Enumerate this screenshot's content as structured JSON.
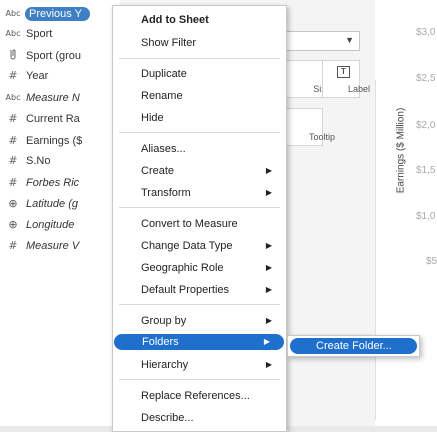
{
  "data_pane": {
    "fields": [
      {
        "type_icon": "Abc",
        "name": "Previous Y",
        "italic": false,
        "selected": true
      },
      {
        "type_icon": "Abc",
        "name": "Sport",
        "italic": false
      },
      {
        "type_icon": "group-icon",
        "glyph": "🔗",
        "name": "Sport (grou",
        "italic": false
      },
      {
        "type_icon": "#",
        "name": "Year",
        "italic": false
      },
      {
        "type_icon": "Abc",
        "name": "Measure N",
        "italic": true
      },
      {
        "type_icon": "#",
        "name": "Current Ra",
        "italic": false
      },
      {
        "type_icon": "#",
        "name": "Earnings ($",
        "italic": false
      },
      {
        "type_icon": "#",
        "name": "S.No",
        "italic": false
      },
      {
        "type_icon": "#",
        "name": "Forbes Ric",
        "italic": true
      },
      {
        "type_icon": "globe-icon",
        "glyph": "⊕",
        "name": "Latitude (g",
        "italic": true
      },
      {
        "type_icon": "globe-icon",
        "glyph": "⊕",
        "name": "Longitude",
        "italic": true
      },
      {
        "type_icon": "#",
        "name": "Measure V",
        "italic": true
      }
    ]
  },
  "marks_card": {
    "size_label": "Size",
    "label_label": "Label",
    "label_glyph": "T",
    "tooltip_label": "Tooltip"
  },
  "chart": {
    "y_axis_label": "Earnings ($ Million)",
    "y_ticks": [
      "$3,0",
      "$2,5",
      "$2,0",
      "$1,5",
      "$1,0",
      "$5"
    ]
  },
  "context_menu": {
    "items": [
      {
        "label": "Add to Sheet",
        "bold": true
      },
      {
        "label": "Show Filter"
      },
      {
        "label": "Duplicate"
      },
      {
        "label": "Rename"
      },
      {
        "label": "Hide"
      },
      {
        "label": "Aliases..."
      },
      {
        "label": "Create",
        "submenu": true
      },
      {
        "label": "Transform",
        "submenu": true
      },
      {
        "label": "Convert to Measure"
      },
      {
        "label": "Change Data Type",
        "submenu": true
      },
      {
        "label": "Geographic Role",
        "submenu": true
      },
      {
        "label": "Default Properties",
        "submenu": true
      },
      {
        "label": "Group by",
        "submenu": true
      },
      {
        "label": "Folders",
        "submenu": true,
        "highlighted": true
      },
      {
        "label": "Hierarchy",
        "submenu": true
      },
      {
        "label": "Replace References..."
      },
      {
        "label": "Describe..."
      }
    ],
    "submenu_arrow": "▶"
  },
  "folders_submenu": {
    "items": [
      {
        "label": "Create Folder...",
        "highlighted": true
      }
    ]
  },
  "colors": {
    "highlight": "#1f6fcd",
    "selected_pill": "#3f7fc4"
  }
}
